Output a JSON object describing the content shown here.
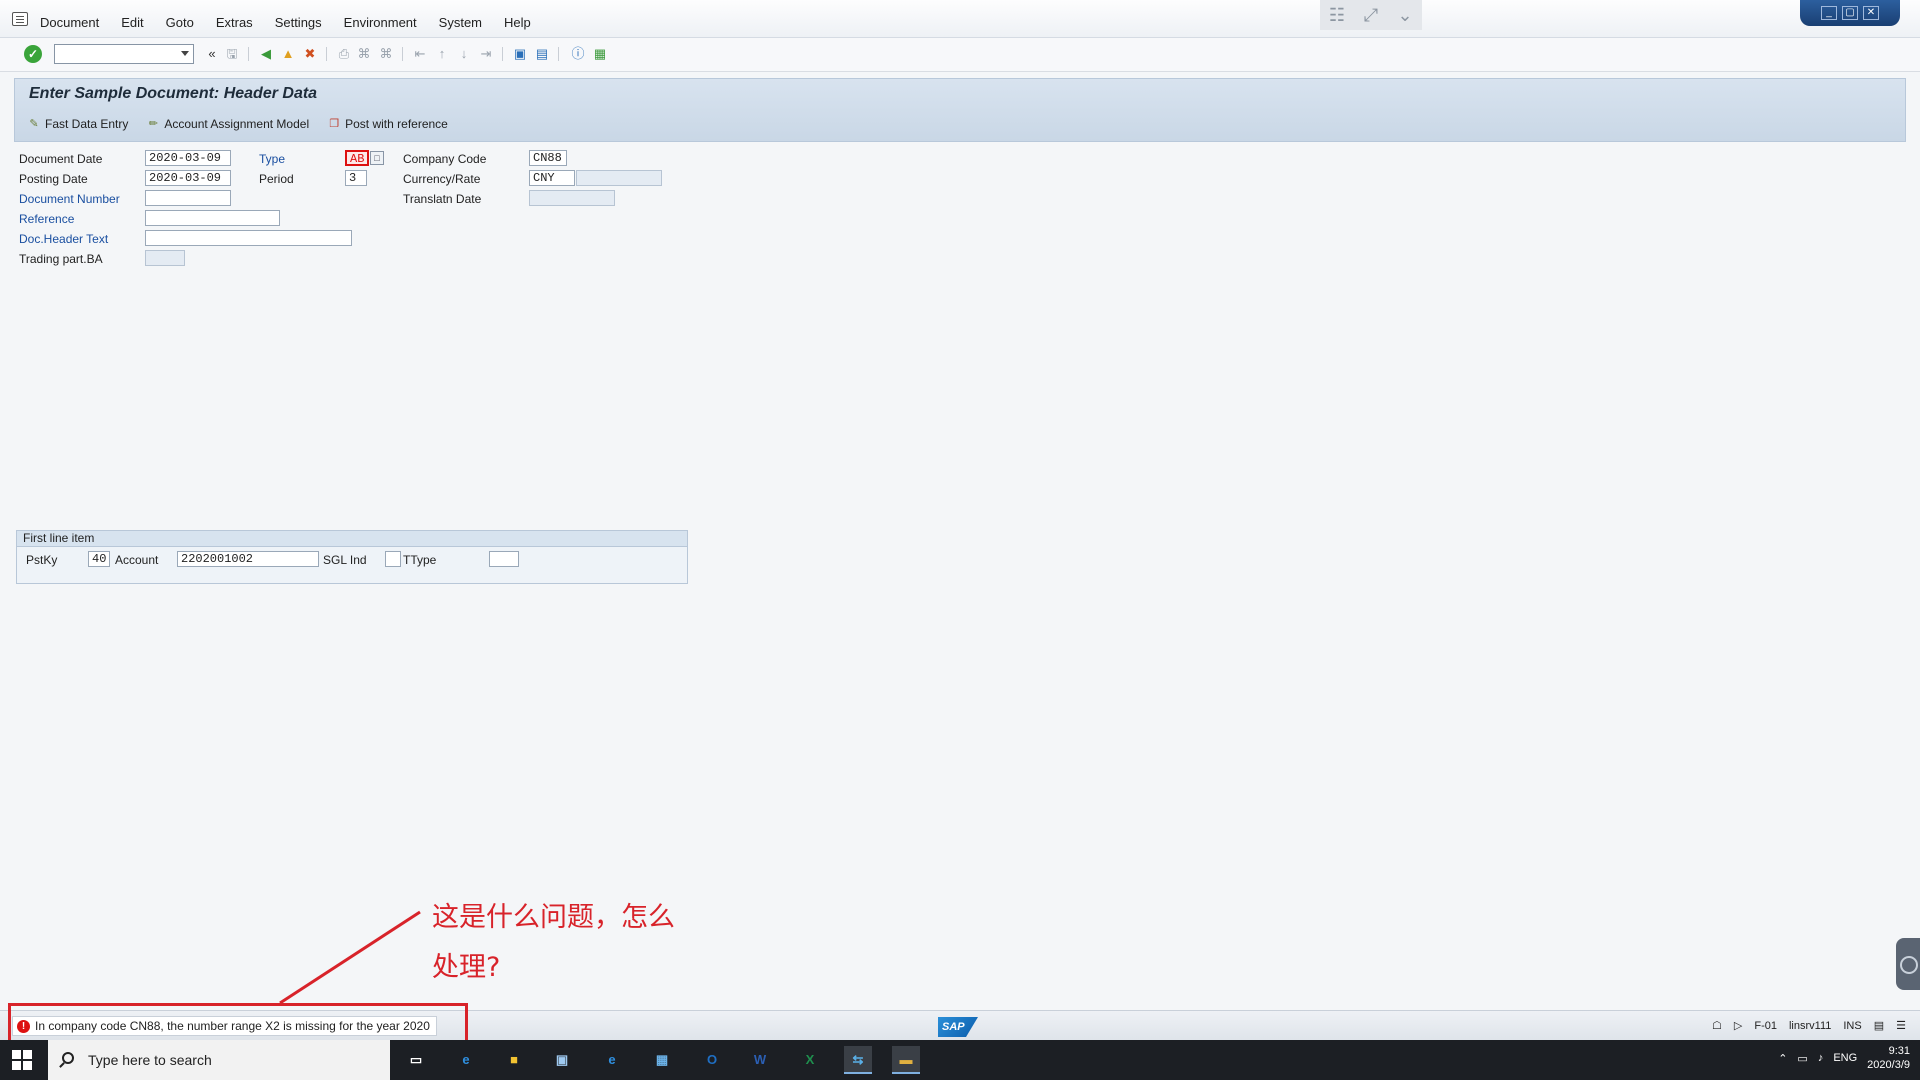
{
  "menubar": {
    "items": [
      "Document",
      "Edit",
      "Goto",
      "Extras",
      "Settings",
      "Environment",
      "System",
      "Help"
    ]
  },
  "page": {
    "title": "Enter Sample Document: Header Data"
  },
  "app_toolbar": {
    "fast_data_entry": "Fast Data Entry",
    "account_assignment_model": "Account Assignment Model",
    "post_with_reference": "Post with reference"
  },
  "header": {
    "document_date": {
      "label": "Document Date",
      "value": "2020-03-09"
    },
    "posting_date": {
      "label": "Posting Date",
      "value": "2020-03-09"
    },
    "document_number": {
      "label": "Document Number",
      "value": ""
    },
    "reference": {
      "label": "Reference",
      "value": ""
    },
    "doc_header_text": {
      "label": "Doc.Header Text",
      "value": ""
    },
    "trading_part_ba": {
      "label": "Trading part.BA",
      "value": ""
    },
    "type": {
      "label": "Type",
      "value": "AB"
    },
    "period": {
      "label": "Period",
      "value": "3"
    },
    "company_code": {
      "label": "Company Code",
      "value": "CN88"
    },
    "currency_rate": {
      "label": "Currency/Rate",
      "currency": "CNY",
      "rate": ""
    },
    "translatn_date": {
      "label": "Translatn Date",
      "value": ""
    }
  },
  "first_line_item": {
    "title": "First line item",
    "pstky": {
      "label": "PstKy",
      "value": "40"
    },
    "account": {
      "label": "Account",
      "value": "2202001002"
    },
    "sgl_ind": {
      "label": "SGL Ind",
      "value": ""
    },
    "ttype": {
      "label": "TType",
      "value": ""
    }
  },
  "annotation": {
    "text_line1": "这是什么问题，怎么",
    "text_line2": "处理?"
  },
  "statusbar": {
    "message": "In company code CN88, the number range X2 is missing for the year 2020",
    "sap_logo": "SAP",
    "transaction": "F-01",
    "server": "linsrv111",
    "mode": "INS"
  },
  "taskbar": {
    "search_placeholder": "Type here to search",
    "lang": "ENG",
    "time": "9:31",
    "date": "2020/3/9"
  }
}
